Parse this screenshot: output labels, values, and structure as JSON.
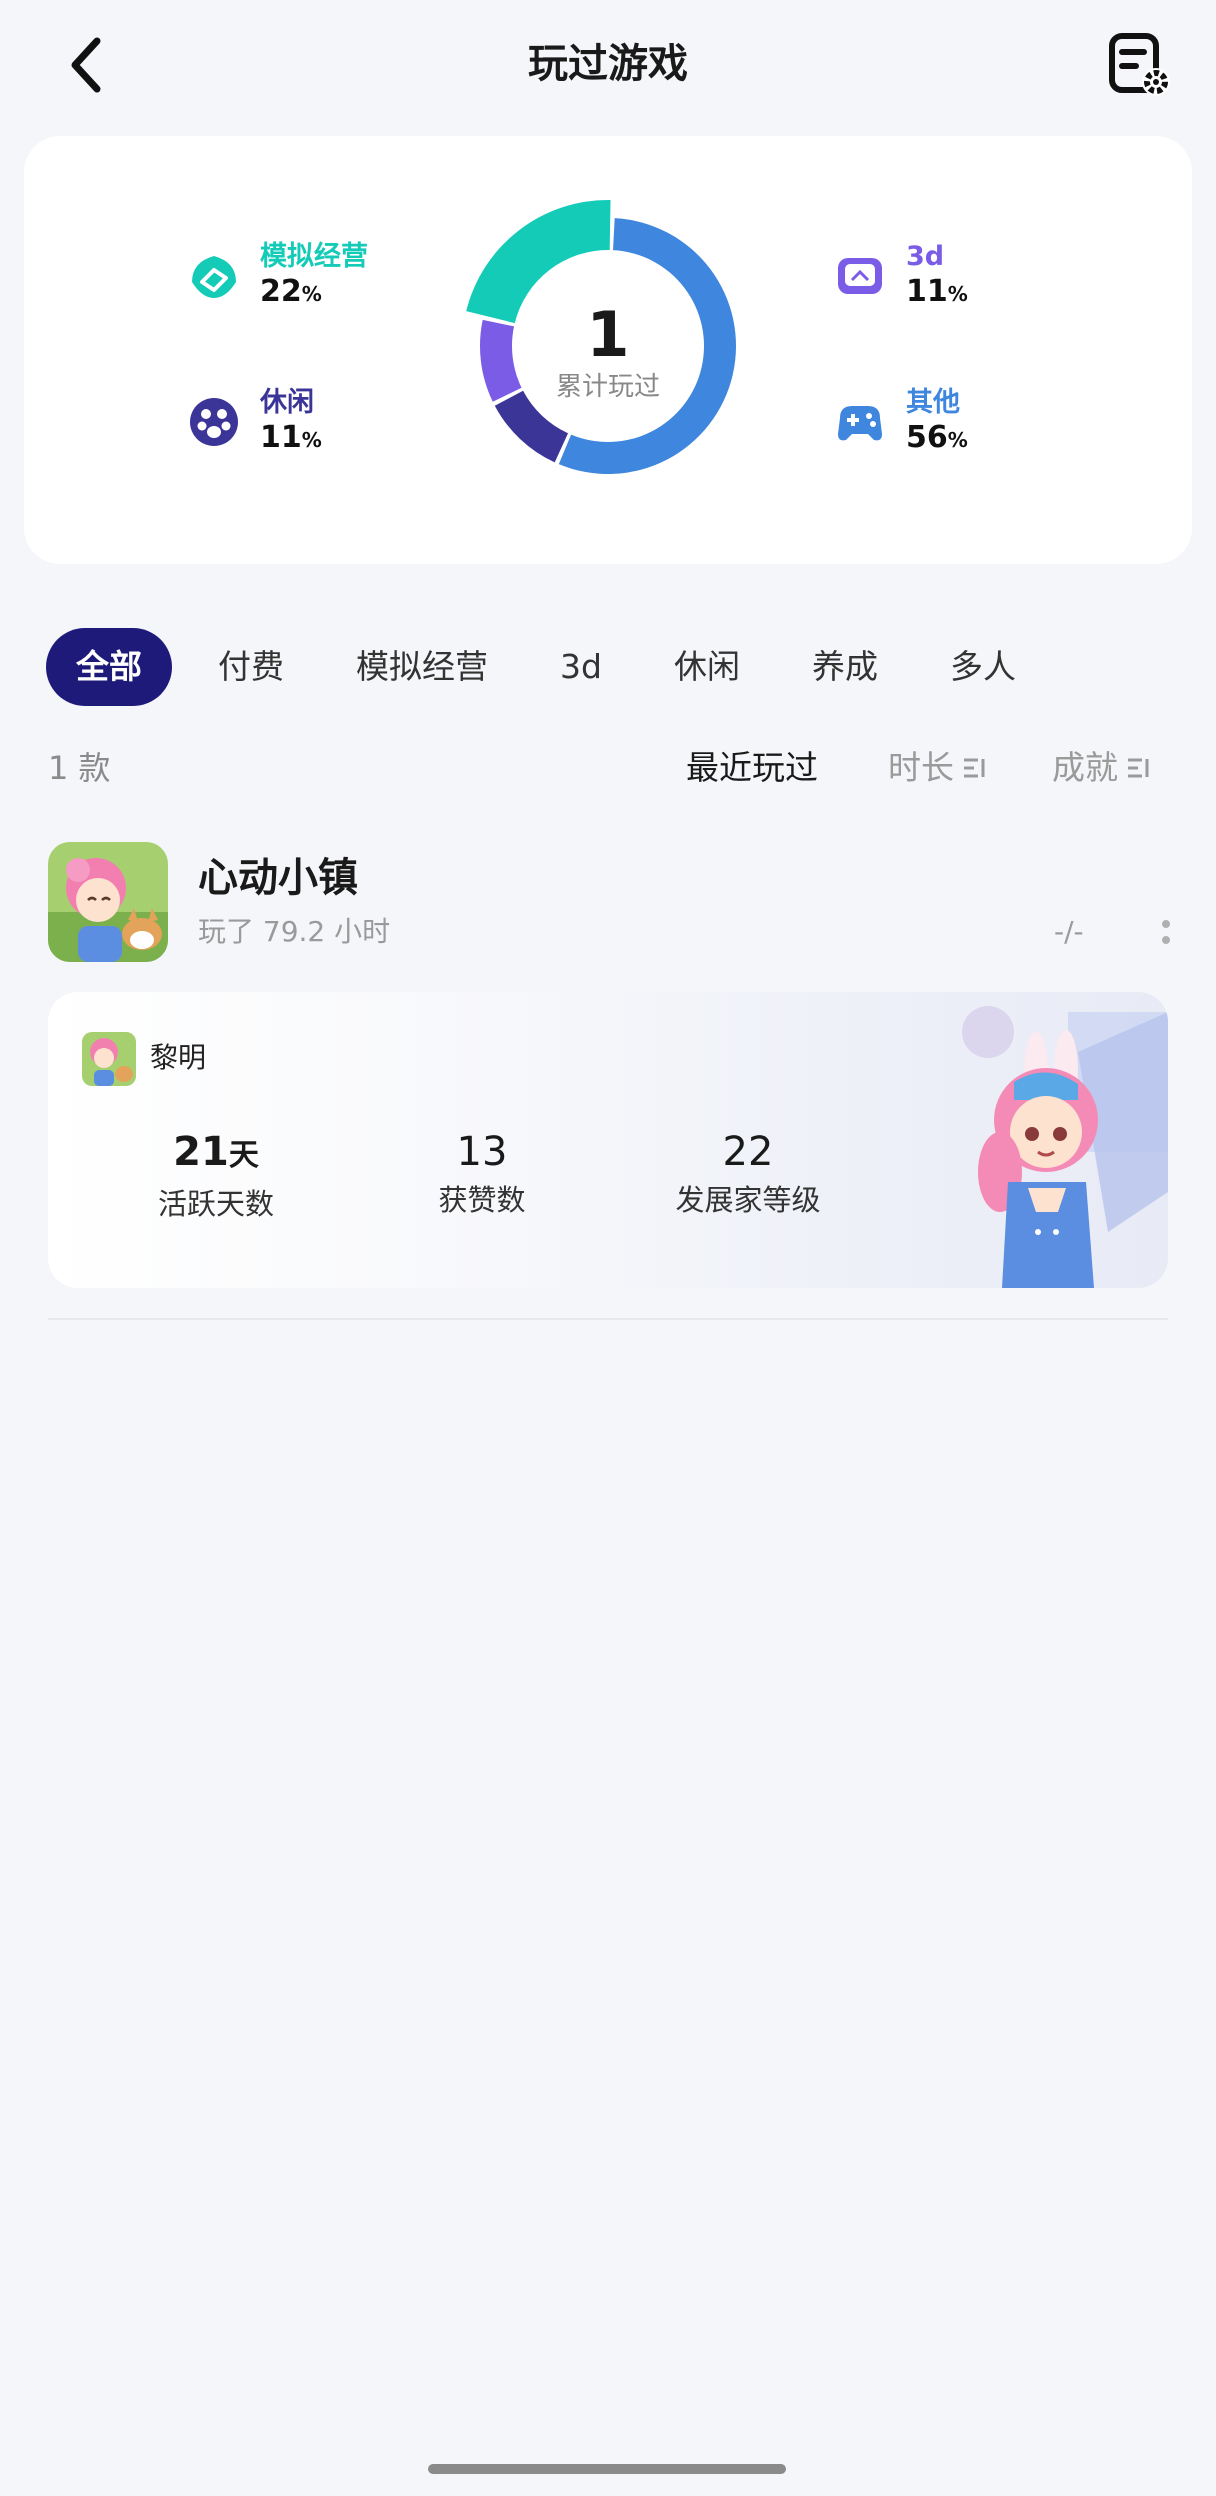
{
  "header": {
    "title": "玩过游戏"
  },
  "stats": {
    "total": "1",
    "total_label": "累计玩过",
    "categories": [
      {
        "name": "模拟经营",
        "percent": "22",
        "unit": "%",
        "color": "#14cbb8",
        "icon": "leaf-icon"
      },
      {
        "name": "休闲",
        "percent": "11",
        "unit": "%",
        "color": "#3b3598",
        "icon": "paw-icon"
      },
      {
        "name": "3d",
        "percent": "11",
        "unit": "%",
        "color": "#7a5ce6",
        "icon": "cube-screen-icon"
      },
      {
        "name": "其他",
        "percent": "56",
        "unit": "%",
        "color": "#3f86de",
        "icon": "gamepad-icon"
      }
    ]
  },
  "tabs": [
    "全部",
    "付费",
    "模拟经营",
    "3d",
    "休闲",
    "养成",
    "多人"
  ],
  "list": {
    "count_text": "1 款",
    "sort_options": [
      "最近玩过",
      "时长",
      "成就"
    ]
  },
  "game": {
    "name": "心动小镇",
    "playtime": "玩了 79.2 小时",
    "score": "-/-",
    "achievement": {
      "role_name": "黎明",
      "stats": [
        {
          "value": "21",
          "unit": "天",
          "label": "活跃天数"
        },
        {
          "value": "13",
          "unit": "",
          "label": "获赞数"
        },
        {
          "value": "22",
          "unit": "",
          "label": "发展家等级"
        }
      ]
    }
  },
  "colors": {
    "accent": "#1d1a7a",
    "background": "#f4f6f9"
  }
}
